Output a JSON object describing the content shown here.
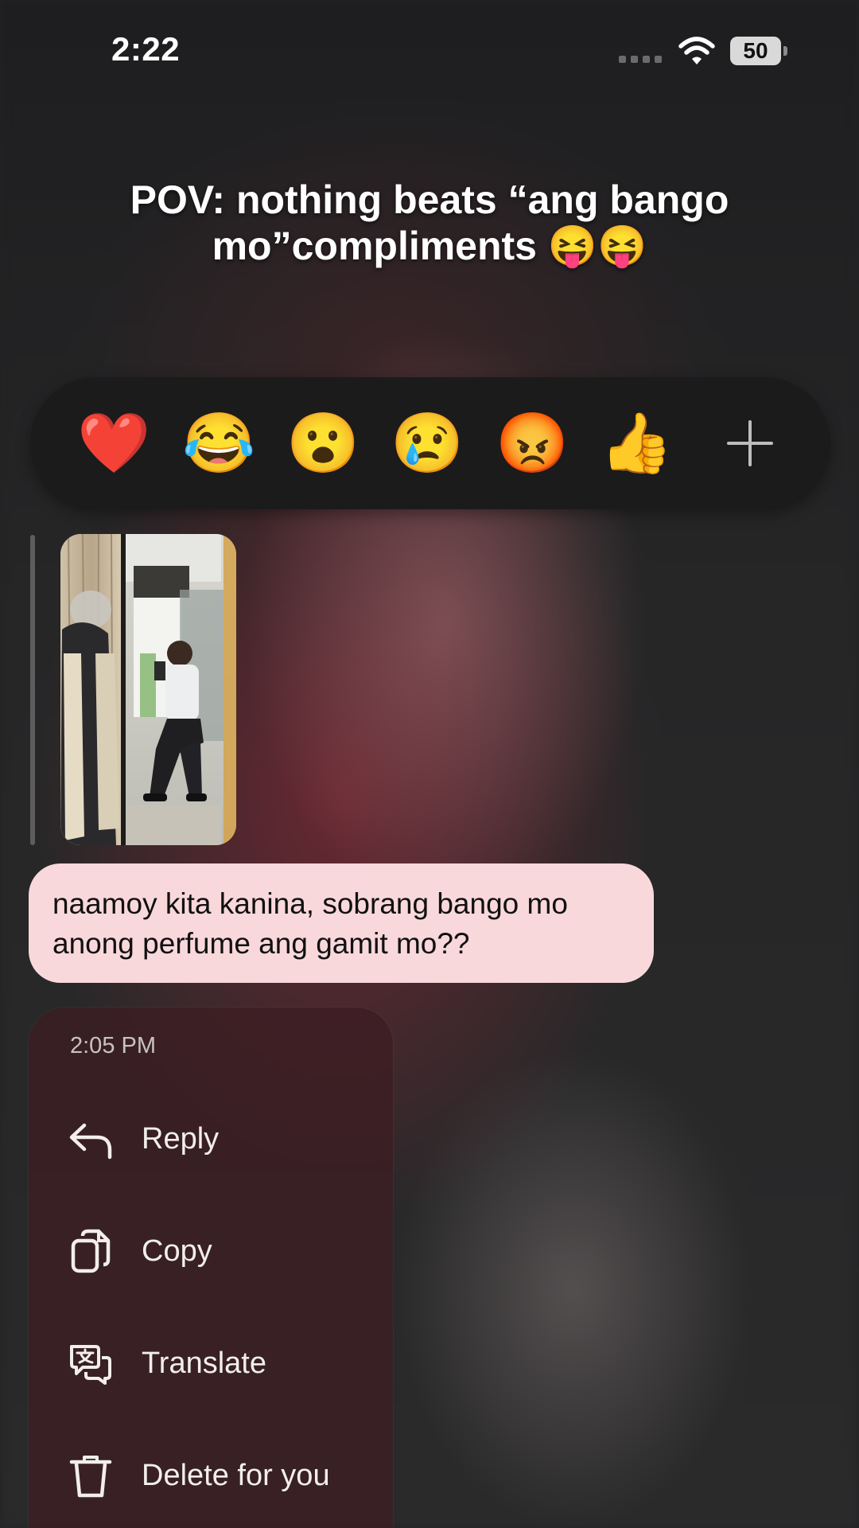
{
  "status_bar": {
    "time": "2:22",
    "battery_level": "50"
  },
  "caption": {
    "line1": "POV: nothing beats “ang bango",
    "line2": "mo”compliments 😝😝"
  },
  "reactions": [
    {
      "icon": "heart-emoji",
      "glyph": "❤️"
    },
    {
      "icon": "laughing-tears-emoji",
      "glyph": "😂"
    },
    {
      "icon": "surprised-emoji",
      "glyph": "😮"
    },
    {
      "icon": "crying-emoji",
      "glyph": "😢"
    },
    {
      "icon": "angry-emoji",
      "glyph": "😡"
    },
    {
      "icon": "thumbs-up-emoji",
      "glyph": "👍"
    }
  ],
  "message": {
    "line1": "naamoy kita kanina, sobrang bango mo",
    "line2": "anong perfume ang gamit mo??",
    "bubble_color": "#f9d8db"
  },
  "menu": {
    "timestamp": "2:05 PM",
    "items": [
      {
        "label": "Reply",
        "icon": "reply-arrow-icon"
      },
      {
        "label": "Copy",
        "icon": "copy-icon"
      },
      {
        "label": "Translate",
        "icon": "translate-icon"
      },
      {
        "label": "Delete for you",
        "icon": "trash-icon"
      }
    ]
  }
}
